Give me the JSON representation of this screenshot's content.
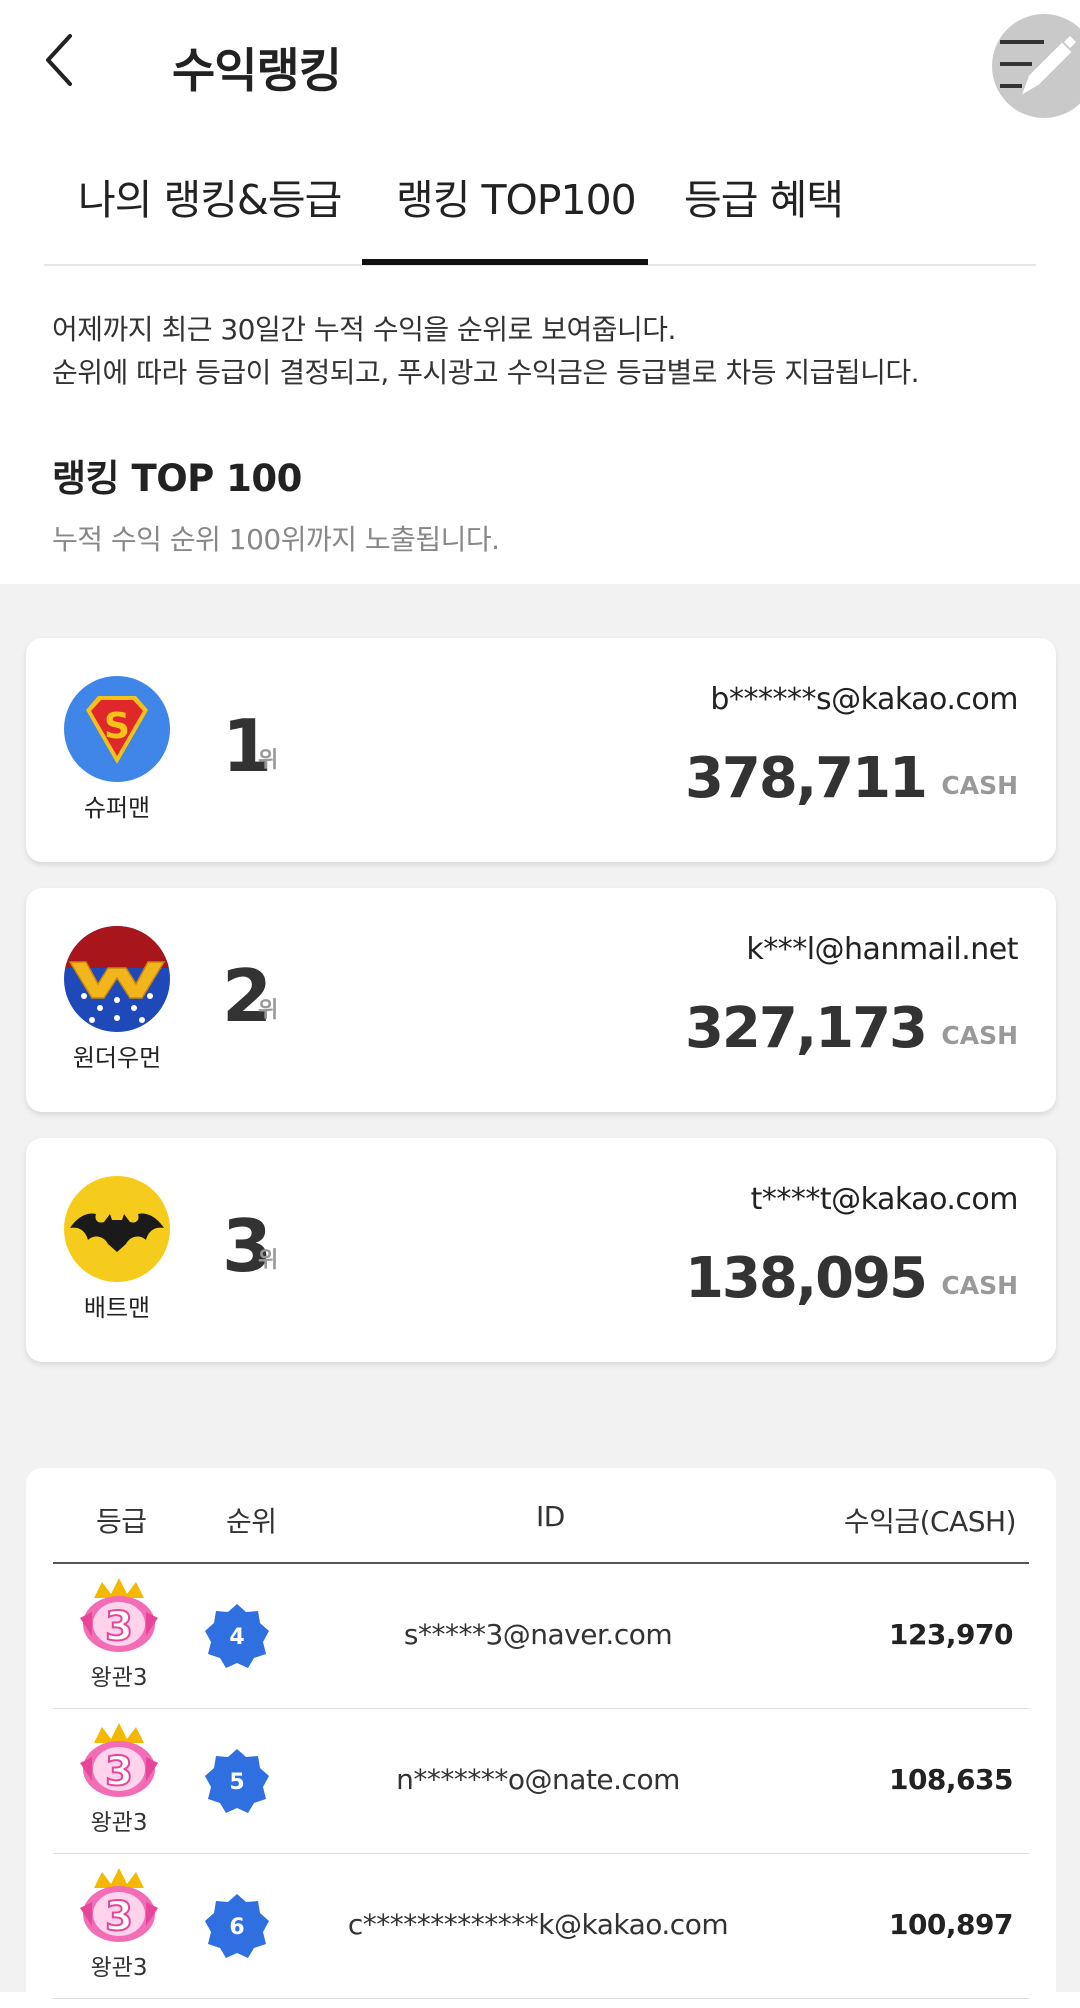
{
  "header": {
    "title": "수익랭킹",
    "back_icon": "chevron-left-icon",
    "fab_icon": "menu-edit-icon"
  },
  "tabs": [
    {
      "label": "나의 랭킹&등급"
    },
    {
      "label": "랭킹 TOP100",
      "active": true
    },
    {
      "label": "등급 혜택"
    }
  ],
  "description": {
    "line1": "어제까지 최근 30일간 누적 수익을 순위로 보여줍니다.",
    "line2": "순위에 따라 등급이 결정되고, 푸시광고 수익금은 등급별로 차등 지급됩니다."
  },
  "section": {
    "title": "랭킹 TOP 100",
    "subtitle": "누적 수익 순위 100위까지 노출됩니다."
  },
  "top3": [
    {
      "rank": "1",
      "rank_unit": "위",
      "hero": "슈퍼맨",
      "hero_icon": "superman-icon",
      "email": "b******s@kakao.com",
      "amount": "378,711",
      "unit": "CASH"
    },
    {
      "rank": "2",
      "rank_unit": "위",
      "hero": "원더우먼",
      "hero_icon": "wonder-woman-icon",
      "email": "k***l@hanmail.net",
      "amount": "327,173",
      "unit": "CASH"
    },
    {
      "rank": "3",
      "rank_unit": "위",
      "hero": "배트맨",
      "hero_icon": "batman-icon",
      "email": "t****t@kakao.com",
      "amount": "138,095",
      "unit": "CASH"
    }
  ],
  "table": {
    "headers": {
      "grade": "등급",
      "rank": "순위",
      "id": "ID",
      "amount": "수익금(CASH)"
    },
    "rows": [
      {
        "grade": "왕관3",
        "grade_badge": "3",
        "rank": "4",
        "id": "s*****3@naver.com",
        "amount": "123,970"
      },
      {
        "grade": "왕관3",
        "grade_badge": "3",
        "rank": "5",
        "id": "n*******o@nate.com",
        "amount": "108,635"
      },
      {
        "grade": "왕관3",
        "grade_badge": "3",
        "rank": "6",
        "id": "c*************k@kakao.com",
        "amount": "100,897"
      }
    ]
  },
  "colors": {
    "rank_badge": "#2f6fe0",
    "crown_pink": "#f06ab4",
    "crown_gold": "#f5b800",
    "gray_bg": "#f2f2f2"
  }
}
